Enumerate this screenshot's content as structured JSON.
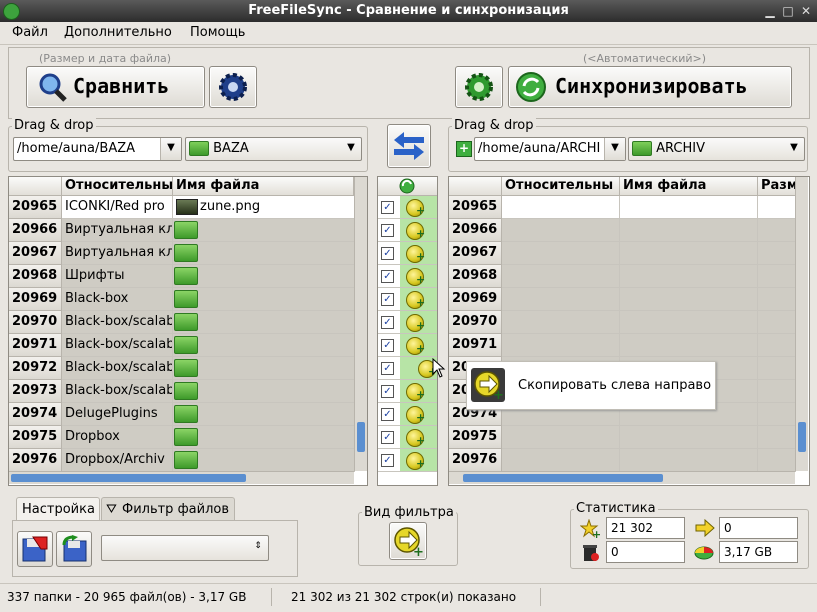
{
  "window": {
    "title": "FreeFileSync - Сравнение и синхронизация"
  },
  "menu": [
    "Файл",
    "Дополнительно",
    "Помощь"
  ],
  "compare": {
    "hint": "(Размер и дата файла)",
    "label": "Сравнить"
  },
  "sync": {
    "hint": "(<Автоматический>)",
    "label": "Синхронизировать"
  },
  "left": {
    "dragdrop": "Drag & drop",
    "path": "/home/auna/BAZA",
    "folder": "BAZA",
    "columns": [
      "Относительны",
      "Имя файла"
    ],
    "rows": [
      {
        "num": "20965",
        "rel": "ICONKI/Red pro",
        "name": "zune.png",
        "type": "file"
      },
      {
        "num": "20966",
        "rel": "Виртуальная кл",
        "name": "",
        "type": "folder"
      },
      {
        "num": "20967",
        "rel": "Виртуальная кл",
        "name": "",
        "type": "folder"
      },
      {
        "num": "20968",
        "rel": "Шрифты",
        "name": "",
        "type": "folder"
      },
      {
        "num": "20969",
        "rel": "Black-box",
        "name": "",
        "type": "folder"
      },
      {
        "num": "20970",
        "rel": "Black-box/scalab",
        "name": "",
        "type": "folder"
      },
      {
        "num": "20971",
        "rel": "Black-box/scalab",
        "name": "",
        "type": "folder"
      },
      {
        "num": "20972",
        "rel": "Black-box/scalab",
        "name": "",
        "type": "folder"
      },
      {
        "num": "20973",
        "rel": "Black-box/scalab",
        "name": "",
        "type": "folder"
      },
      {
        "num": "20974",
        "rel": "DelugePlugins",
        "name": "",
        "type": "folder"
      },
      {
        "num": "20975",
        "rel": "Dropbox",
        "name": "",
        "type": "folder"
      },
      {
        "num": "20976",
        "rel": "Dropbox/Archiv",
        "name": "",
        "type": "folder"
      }
    ]
  },
  "right": {
    "dragdrop": "Drag & drop",
    "path": "/home/auna/ARCHI",
    "folder": "ARCHIV",
    "columns": [
      "Относительны",
      "Имя файла",
      "Разм"
    ],
    "rows": [
      "20965",
      "20966",
      "20967",
      "20968",
      "20969",
      "20970",
      "20971",
      "20972",
      "20973",
      "20974",
      "20975",
      "20976"
    ]
  },
  "tooltip": "Скопировать слева направо",
  "tabs": [
    "Настройка",
    "Фильтр файлов"
  ],
  "filterview": {
    "label": "Вид фильтра"
  },
  "stats": {
    "label": "Статистика",
    "create_count": "21 302",
    "copy_count": "0",
    "delete_count": "0",
    "size": "3,17 GB"
  },
  "status": {
    "left": "337 папки - 20 965 файл(ов) - 3,17 GB",
    "middle": "21 302 из 21 302 строк(и) показано"
  }
}
